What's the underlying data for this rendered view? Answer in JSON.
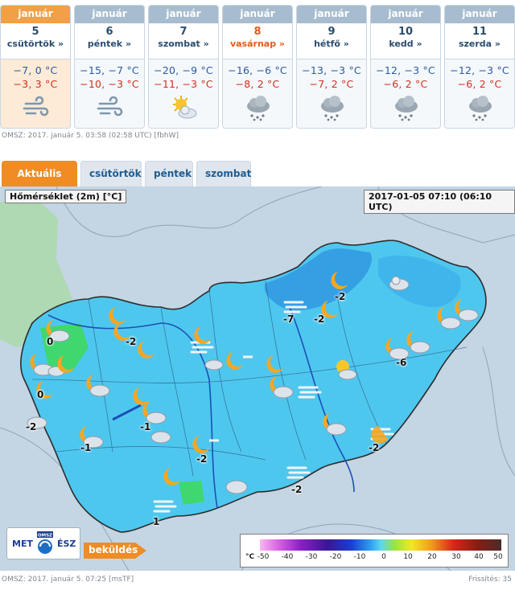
{
  "forecast": {
    "days": [
      {
        "month": "január",
        "day": "5",
        "name": "csütörtök »",
        "max": "−7, 0 °C",
        "min": "−3, 3 °C",
        "icon": "wind-icon",
        "sunday": false,
        "today": true
      },
      {
        "month": "január",
        "day": "6",
        "name": "péntek »",
        "max": "−15, −7 °C",
        "min": "−10, −3 °C",
        "icon": "wind-icon",
        "sunday": false,
        "today": false
      },
      {
        "month": "január",
        "day": "7",
        "name": "szombat »",
        "max": "−20, −9 °C",
        "min": "−11, −3 °C",
        "icon": "sun-cloud-icon",
        "sunday": false,
        "today": false
      },
      {
        "month": "január",
        "day": "8",
        "name": "vasárnap »",
        "max": "−16, −6 °C",
        "min": "−8, 2 °C",
        "icon": "snow-cloud-icon",
        "sunday": true,
        "today": false
      },
      {
        "month": "január",
        "day": "9",
        "name": "hétfő »",
        "max": "−13, −3 °C",
        "min": "−7, 2 °C",
        "icon": "snow-cloud-icon",
        "sunday": false,
        "today": false
      },
      {
        "month": "január",
        "day": "10",
        "name": "kedd »",
        "max": "−12, −3 °C",
        "min": "−6, 2 °C",
        "icon": "snow-cloud-icon",
        "sunday": false,
        "today": false
      },
      {
        "month": "január",
        "day": "11",
        "name": "szerda »",
        "max": "−12, −3 °C",
        "min": "−6, 2 °C",
        "icon": "snow-cloud-icon",
        "sunday": false,
        "today": false
      }
    ],
    "source_line": "OMSZ: 2017. január 5. 03:58 (02:58  UTC)  [fbhW]"
  },
  "tabs": [
    {
      "label": "Aktuális idő",
      "active": true
    },
    {
      "label": "csütörtök",
      "active": false
    },
    {
      "label": "péntek",
      "active": false
    },
    {
      "label": "szombat",
      "active": false
    }
  ],
  "map": {
    "title": "Hőmérséklet (2m) [°C]",
    "timestamp": "2017-01-05 07:10 (06:10 UTC)",
    "temperatures": [
      "-2",
      "-7",
      "-2",
      "0",
      "-2",
      "-6",
      "0",
      "-1",
      "-2",
      "-1",
      "-2",
      "-2",
      "-2",
      "1"
    ],
    "logo": {
      "left": "MET",
      "right": "ÉSZ",
      "badge": "OMSZ"
    },
    "send_button": "beküldés",
    "legend": {
      "unit": "°C",
      "ticks": [
        "-50",
        "-40",
        "-30",
        "-20",
        "-10",
        "0",
        "10",
        "20",
        "30",
        "40",
        "50"
      ],
      "colors": [
        "#f5b8f0",
        "#d75fe3",
        "#8a1fc6",
        "#3a1596",
        "#1a3fd3",
        "#2fa1ef",
        "#5ad7f1",
        "#9be53d",
        "#f2e627",
        "#f29a1d",
        "#d8281a",
        "#8a1c12",
        "#4a2c2a"
      ]
    }
  },
  "footer": {
    "source_line": "OMSZ: 2017. január 5. 07:25 [msTF]",
    "refresh": "Frissítés: 35"
  },
  "colors": {
    "accent": "#f08c24",
    "header": "#a7bccf",
    "link": "#1f5d91"
  }
}
